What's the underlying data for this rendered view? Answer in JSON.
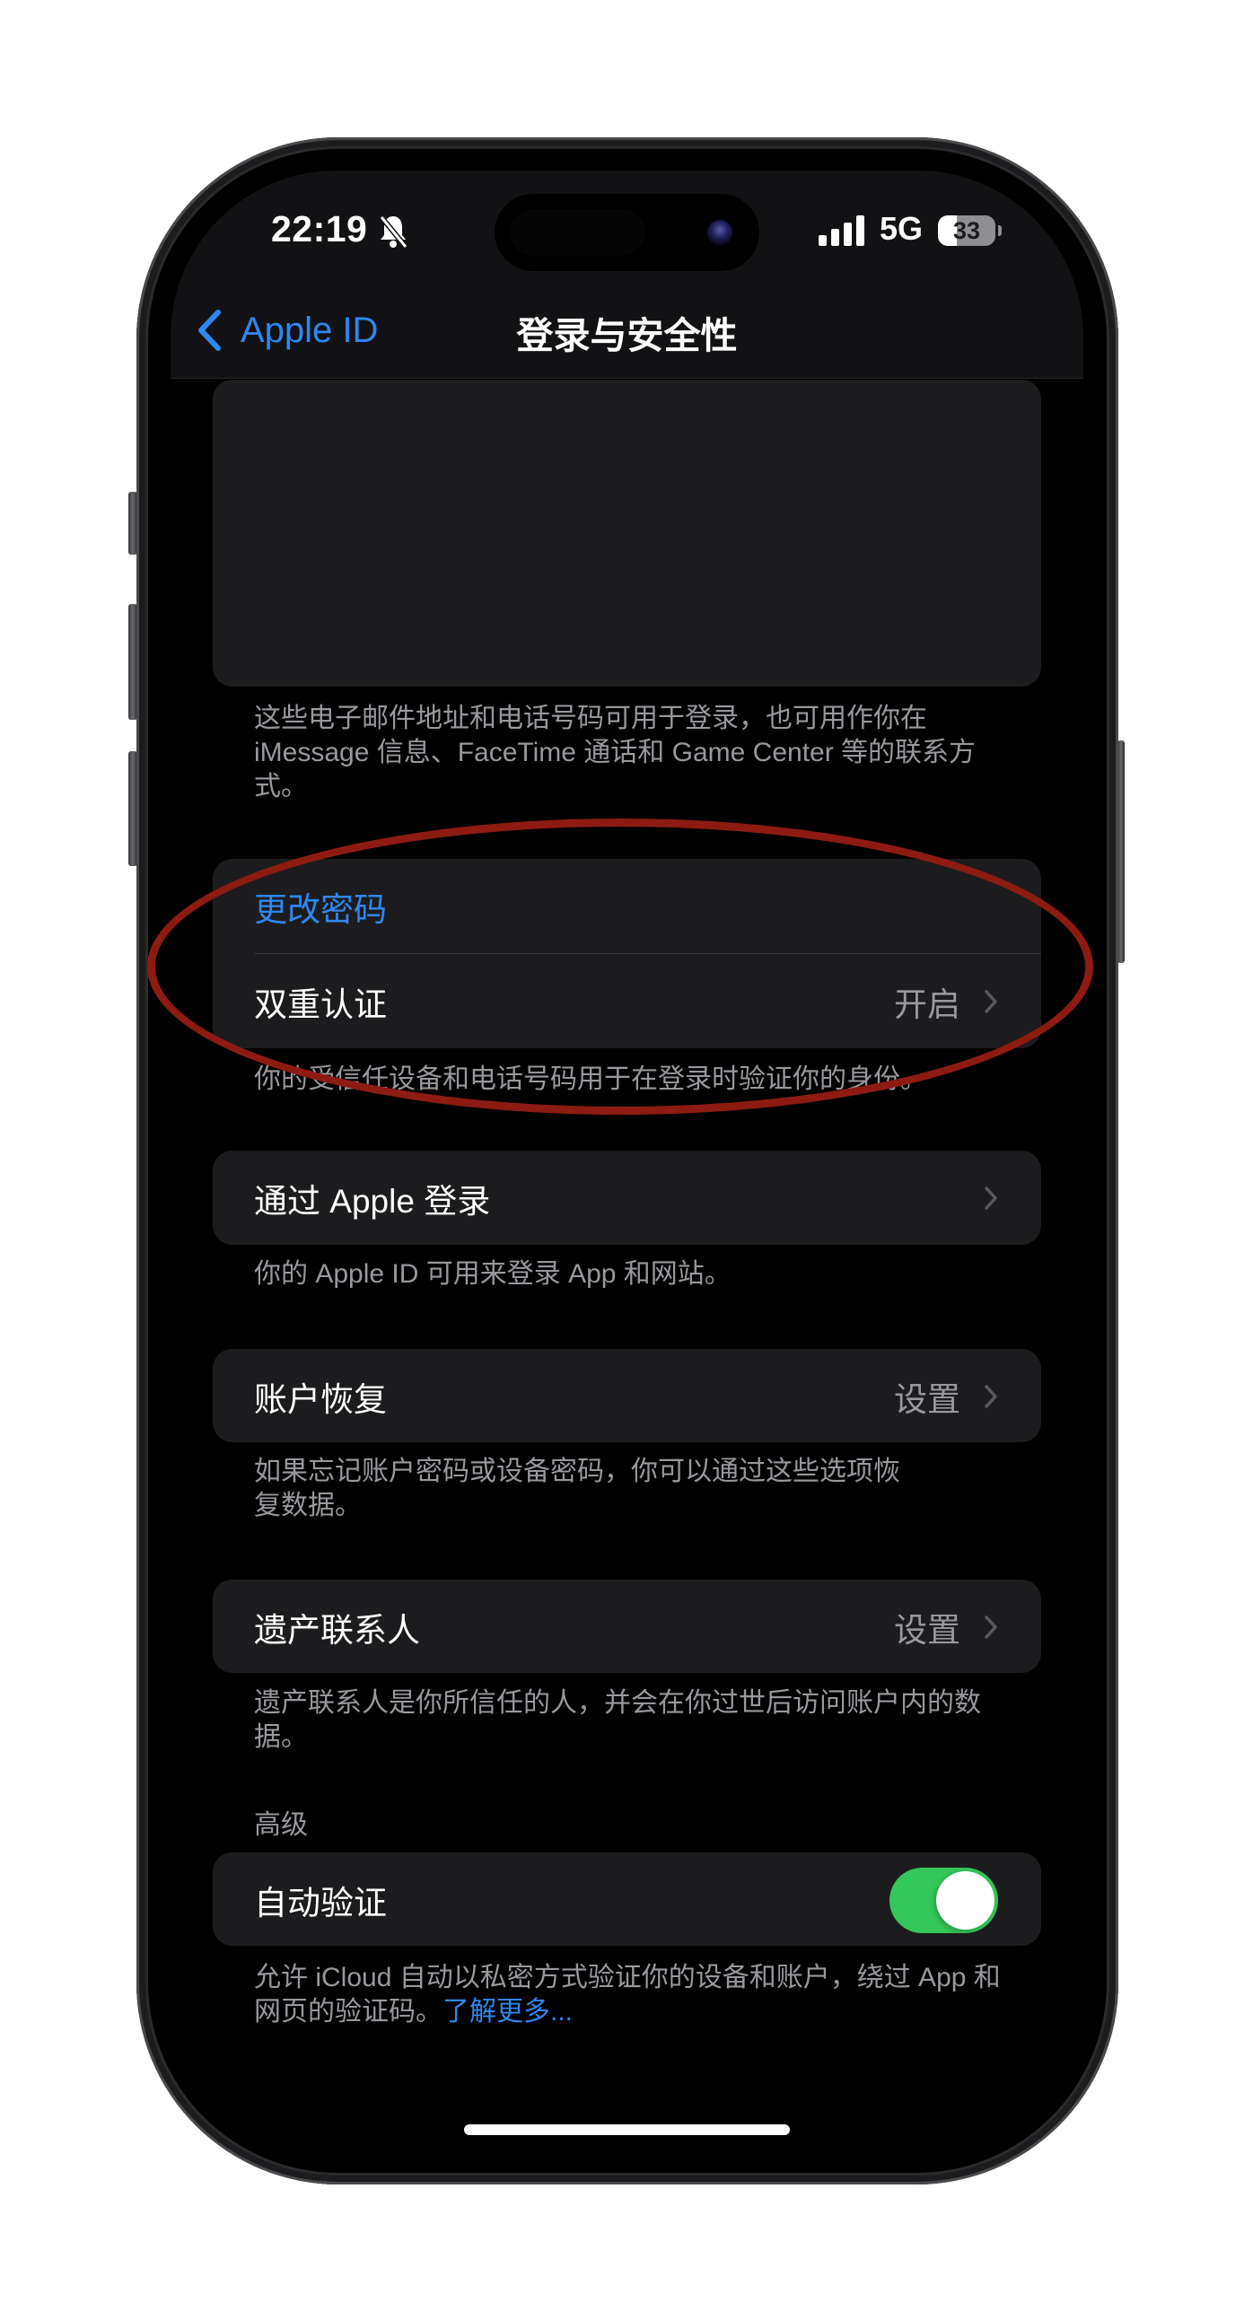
{
  "status_bar": {
    "time": "22:19",
    "silent_icon": "bell-slash-icon",
    "signal_icon": "cellular-signal-icon",
    "network": "5G",
    "battery_percent": 33,
    "battery_label": "33"
  },
  "nav": {
    "back_label": "Apple ID",
    "back_icon": "chevron-left-icon",
    "title": "登录与安全性"
  },
  "sections": {
    "contacts": {
      "footer": "这些电子邮件地址和电话号码可用于登录，也可用作你在 iMessage 信息、FaceTime 通话和 Game Center 等的联系方式。"
    },
    "security": {
      "change_password": "更改密码",
      "two_factor_label": "双重认证",
      "two_factor_value": "开启",
      "footer": "你的受信任设备和电话号码用于在登录时验证你的身份。"
    },
    "sign_in_with_apple": {
      "label": "通过 Apple 登录",
      "footer": "你的 Apple ID 可用来登录 App 和网站。"
    },
    "account_recovery": {
      "label": "账户恢复",
      "value": "设置",
      "footer": "如果忘记账户密码或设备密码，你可以通过这些选项恢复数据。"
    },
    "legacy_contact": {
      "label": "遗产联系人",
      "value": "设置",
      "footer": "遗产联系人是你所信任的人，并会在你过世后访问账户内的数据。"
    },
    "advanced": {
      "header": "高级",
      "auto_verify_label": "自动验证",
      "auto_verify_on": true,
      "footer_text": "允许 iCloud 自动以私密方式验证你的设备和账户，绕过 App 和网页的验证码。",
      "footer_link": "了解更多..."
    }
  },
  "colors": {
    "accent": "#2f87f0",
    "toggle_on": "#34c759",
    "annotation": "#8d1b12",
    "cell_bg": "#1c1c1e",
    "secondary_text": "#98989e"
  }
}
